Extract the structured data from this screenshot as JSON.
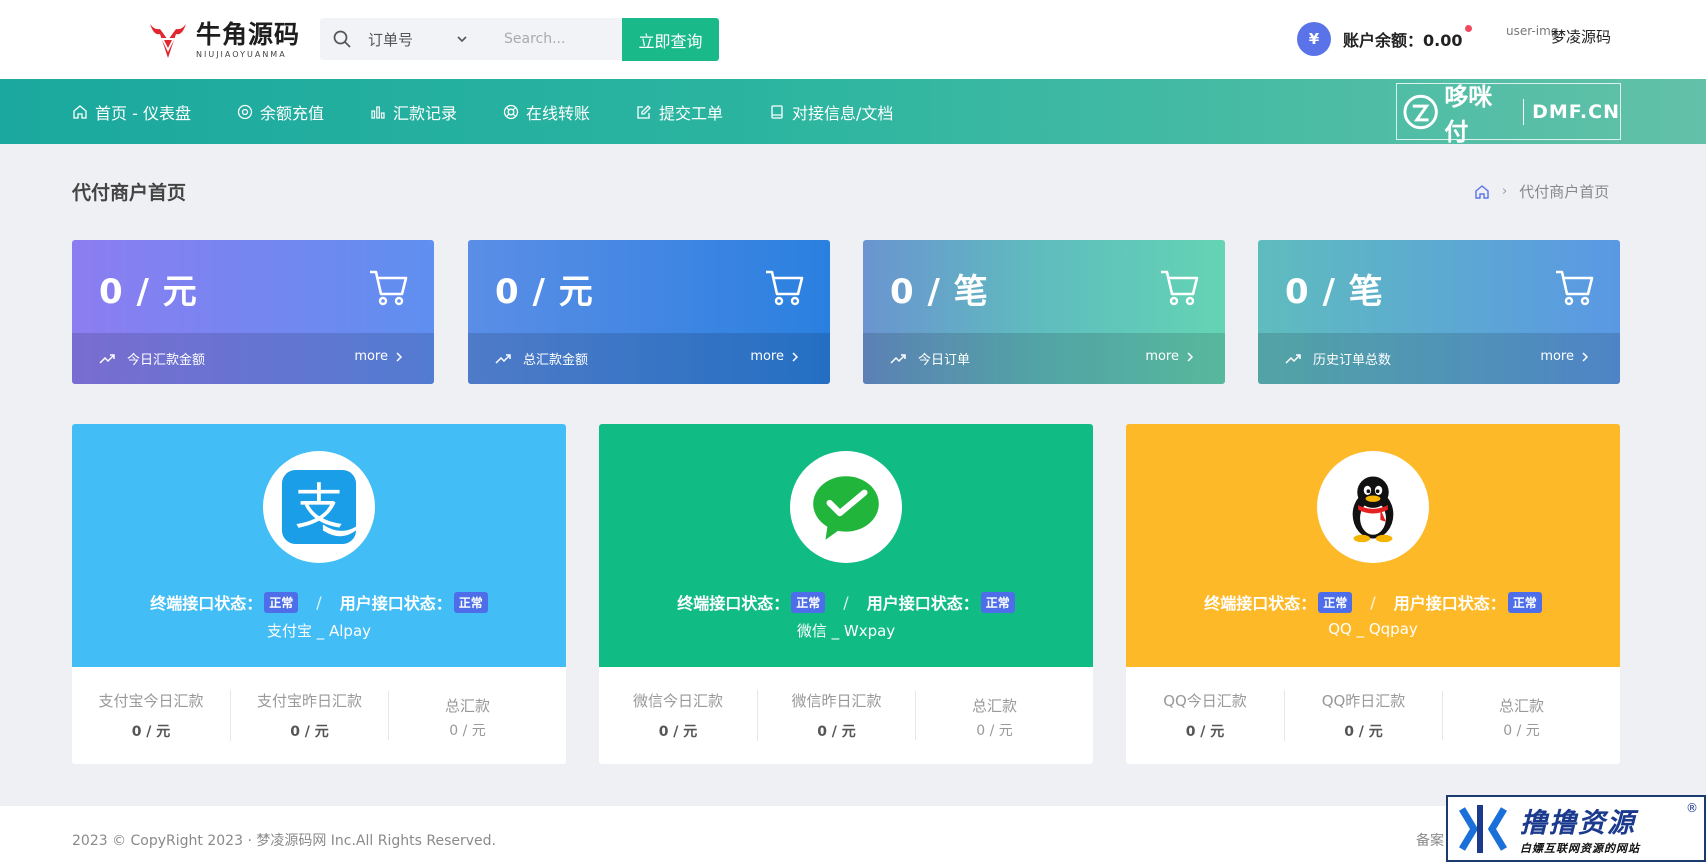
{
  "header": {
    "logo_cn": "牛角源码",
    "logo_en": "NIUJIAOYUANMA",
    "search_type": "订单号",
    "search_placeholder": "Search...",
    "search_button": "立即查询",
    "balance_symbol": "¥",
    "balance_label": "账户余额：0.00",
    "user_img_alt": "user-img",
    "user_name": "梦凌源码"
  },
  "nav": {
    "items": [
      {
        "label": "首页 - 仪表盘",
        "icon": "home-icon"
      },
      {
        "label": "余额充值",
        "icon": "target-icon"
      },
      {
        "label": "汇款记录",
        "icon": "bar-chart-icon"
      },
      {
        "label": "在线转账",
        "icon": "lifebuoy-icon"
      },
      {
        "label": "提交工单",
        "icon": "edit-icon"
      },
      {
        "label": "对接信息/文档",
        "icon": "book-icon"
      }
    ],
    "brand_cn": "哆咪付",
    "brand_en": "DMF.CN"
  },
  "page": {
    "title": "代付商户首页",
    "breadcrumb": "代付商户首页"
  },
  "stats": [
    {
      "value": "0 / 元",
      "label": "今日汇款金额",
      "more": "more"
    },
    {
      "value": "0 / 元",
      "label": "总汇款金额",
      "more": "more"
    },
    {
      "value": "0 / 笔",
      "label": "今日订单",
      "more": "more"
    },
    {
      "value": "0 / 笔",
      "label": "历史订单总数",
      "more": "more"
    }
  ],
  "pay": [
    {
      "terminal_label": "终端接口状态：",
      "terminal_status": "正常",
      "user_label": "用户接口状态：",
      "user_status": "正常",
      "slash": "/",
      "name": "支付宝 _ Alpay",
      "col1_label": "支付宝今日汇款",
      "col1_val": "0 / 元",
      "col2_label": "支付宝昨日汇款",
      "col2_val": "0 / 元",
      "col3_label": "总汇款",
      "col3_val": "0 / 元",
      "color": "#42bdf6"
    },
    {
      "terminal_label": "终端接口状态：",
      "terminal_status": "正常",
      "user_label": "用户接口状态：",
      "user_status": "正常",
      "slash": "/",
      "name": "微信 _ Wxpay",
      "col1_label": "微信今日汇款",
      "col1_val": "0 / 元",
      "col2_label": "微信昨日汇款",
      "col2_val": "0 / 元",
      "col3_label": "总汇款",
      "col3_val": "0 / 元",
      "color": "#10bb84"
    },
    {
      "terminal_label": "终端接口状态：",
      "terminal_status": "正常",
      "user_label": "用户接口状态：",
      "user_status": "正常",
      "slash": "/",
      "name": "QQ _ Qqpay",
      "col1_label": "QQ今日汇款",
      "col1_val": "0 / 元",
      "col2_label": "QQ昨日汇款",
      "col2_val": "0 / 元",
      "col3_label": "总汇款",
      "col3_val": "0 / 元",
      "color": "#fdb927"
    }
  ],
  "footer": {
    "copyright": "2023 © CopyRight 2023 · 梦凌源码网 Inc.All Rights Reserved.",
    "beian": "备案"
  },
  "watermark": {
    "cn": "撸撸资源",
    "sub": "白嫖互联网资源的网站",
    "reg": "®"
  }
}
